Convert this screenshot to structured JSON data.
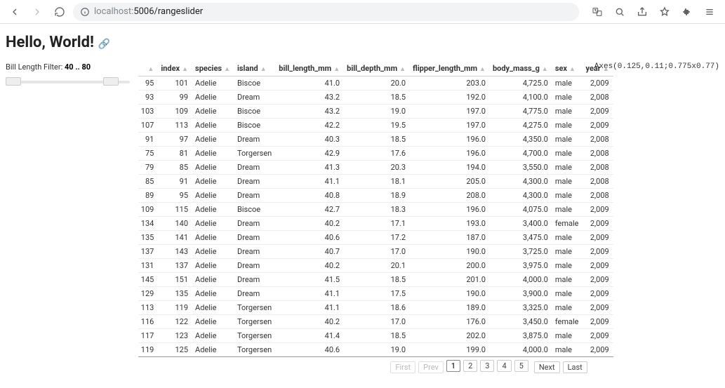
{
  "browser": {
    "url_host": "localhost:",
    "url_path": "5006/rangeslider"
  },
  "page": {
    "title": "Hello, World!",
    "slider_label_prefix": "Bill Length Filter: ",
    "slider_values": "40 .. 80",
    "slider_min_pct": 0,
    "slider_max_pct": 78,
    "axes_text": "Axes(0.125,0.11;0.775x0.77)"
  },
  "columns": [
    {
      "key": "rownum",
      "label": "",
      "num": true
    },
    {
      "key": "index",
      "label": "index",
      "num": true
    },
    {
      "key": "species",
      "label": "species",
      "num": false
    },
    {
      "key": "island",
      "label": "island",
      "num": false
    },
    {
      "key": "bill_length_mm",
      "label": "bill_length_mm",
      "num": true
    },
    {
      "key": "bill_depth_mm",
      "label": "bill_depth_mm",
      "num": true
    },
    {
      "key": "flipper_length_mm",
      "label": "flipper_length_mm",
      "num": true
    },
    {
      "key": "body_mass_g",
      "label": "body_mass_g",
      "num": true
    },
    {
      "key": "sex",
      "label": "sex",
      "num": false
    },
    {
      "key": "year",
      "label": "year",
      "num": true
    }
  ],
  "rows": [
    {
      "rownum": "95",
      "index": "101",
      "species": "Adelie",
      "island": "Biscoe",
      "bill_length_mm": "41.0",
      "bill_depth_mm": "20.0",
      "flipper_length_mm": "203.0",
      "body_mass_g": "4,725.0",
      "sex": "male",
      "year": "2,009"
    },
    {
      "rownum": "93",
      "index": "99",
      "species": "Adelie",
      "island": "Dream",
      "bill_length_mm": "43.2",
      "bill_depth_mm": "18.5",
      "flipper_length_mm": "192.0",
      "body_mass_g": "4,100.0",
      "sex": "male",
      "year": "2,008"
    },
    {
      "rownum": "103",
      "index": "109",
      "species": "Adelie",
      "island": "Biscoe",
      "bill_length_mm": "43.2",
      "bill_depth_mm": "19.0",
      "flipper_length_mm": "197.0",
      "body_mass_g": "4,775.0",
      "sex": "male",
      "year": "2,009"
    },
    {
      "rownum": "107",
      "index": "113",
      "species": "Adelie",
      "island": "Biscoe",
      "bill_length_mm": "42.2",
      "bill_depth_mm": "19.5",
      "flipper_length_mm": "197.0",
      "body_mass_g": "4,275.0",
      "sex": "male",
      "year": "2,009"
    },
    {
      "rownum": "91",
      "index": "97",
      "species": "Adelie",
      "island": "Dream",
      "bill_length_mm": "40.3",
      "bill_depth_mm": "18.5",
      "flipper_length_mm": "196.0",
      "body_mass_g": "4,350.0",
      "sex": "male",
      "year": "2,008"
    },
    {
      "rownum": "75",
      "index": "81",
      "species": "Adelie",
      "island": "Torgersen",
      "bill_length_mm": "42.9",
      "bill_depth_mm": "17.6",
      "flipper_length_mm": "196.0",
      "body_mass_g": "4,700.0",
      "sex": "male",
      "year": "2,008"
    },
    {
      "rownum": "79",
      "index": "85",
      "species": "Adelie",
      "island": "Dream",
      "bill_length_mm": "41.3",
      "bill_depth_mm": "20.3",
      "flipper_length_mm": "194.0",
      "body_mass_g": "3,550.0",
      "sex": "male",
      "year": "2,008"
    },
    {
      "rownum": "85",
      "index": "91",
      "species": "Adelie",
      "island": "Dream",
      "bill_length_mm": "41.1",
      "bill_depth_mm": "18.1",
      "flipper_length_mm": "205.0",
      "body_mass_g": "4,300.0",
      "sex": "male",
      "year": "2,008"
    },
    {
      "rownum": "89",
      "index": "95",
      "species": "Adelie",
      "island": "Dream",
      "bill_length_mm": "40.8",
      "bill_depth_mm": "18.9",
      "flipper_length_mm": "208.0",
      "body_mass_g": "4,300.0",
      "sex": "male",
      "year": "2,008"
    },
    {
      "rownum": "109",
      "index": "115",
      "species": "Adelie",
      "island": "Biscoe",
      "bill_length_mm": "42.7",
      "bill_depth_mm": "18.3",
      "flipper_length_mm": "196.0",
      "body_mass_g": "4,075.0",
      "sex": "male",
      "year": "2,009"
    },
    {
      "rownum": "134",
      "index": "140",
      "species": "Adelie",
      "island": "Dream",
      "bill_length_mm": "40.2",
      "bill_depth_mm": "17.1",
      "flipper_length_mm": "193.0",
      "body_mass_g": "3,400.0",
      "sex": "female",
      "year": "2,009"
    },
    {
      "rownum": "135",
      "index": "141",
      "species": "Adelie",
      "island": "Dream",
      "bill_length_mm": "40.6",
      "bill_depth_mm": "17.2",
      "flipper_length_mm": "187.0",
      "body_mass_g": "3,475.0",
      "sex": "male",
      "year": "2,009"
    },
    {
      "rownum": "137",
      "index": "143",
      "species": "Adelie",
      "island": "Dream",
      "bill_length_mm": "40.7",
      "bill_depth_mm": "17.0",
      "flipper_length_mm": "190.0",
      "body_mass_g": "3,725.0",
      "sex": "male",
      "year": "2,009"
    },
    {
      "rownum": "131",
      "index": "137",
      "species": "Adelie",
      "island": "Dream",
      "bill_length_mm": "40.2",
      "bill_depth_mm": "20.1",
      "flipper_length_mm": "200.0",
      "body_mass_g": "3,975.0",
      "sex": "male",
      "year": "2,009"
    },
    {
      "rownum": "145",
      "index": "151",
      "species": "Adelie",
      "island": "Dream",
      "bill_length_mm": "41.5",
      "bill_depth_mm": "18.5",
      "flipper_length_mm": "201.0",
      "body_mass_g": "4,000.0",
      "sex": "male",
      "year": "2,009"
    },
    {
      "rownum": "129",
      "index": "135",
      "species": "Adelie",
      "island": "Dream",
      "bill_length_mm": "41.1",
      "bill_depth_mm": "17.5",
      "flipper_length_mm": "190.0",
      "body_mass_g": "3,900.0",
      "sex": "male",
      "year": "2,009"
    },
    {
      "rownum": "113",
      "index": "119",
      "species": "Adelie",
      "island": "Torgersen",
      "bill_length_mm": "41.1",
      "bill_depth_mm": "18.6",
      "flipper_length_mm": "189.0",
      "body_mass_g": "3,325.0",
      "sex": "male",
      "year": "2,009"
    },
    {
      "rownum": "116",
      "index": "122",
      "species": "Adelie",
      "island": "Torgersen",
      "bill_length_mm": "40.2",
      "bill_depth_mm": "17.0",
      "flipper_length_mm": "176.0",
      "body_mass_g": "3,450.0",
      "sex": "female",
      "year": "2,009"
    },
    {
      "rownum": "117",
      "index": "123",
      "species": "Adelie",
      "island": "Torgersen",
      "bill_length_mm": "41.4",
      "bill_depth_mm": "18.5",
      "flipper_length_mm": "202.0",
      "body_mass_g": "3,875.0",
      "sex": "male",
      "year": "2,009"
    },
    {
      "rownum": "119",
      "index": "125",
      "species": "Adelie",
      "island": "Torgersen",
      "bill_length_mm": "40.6",
      "bill_depth_mm": "19.0",
      "flipper_length_mm": "199.0",
      "body_mass_g": "4,000.0",
      "sex": "male",
      "year": "2,009"
    }
  ],
  "pager": {
    "first": "First",
    "prev": "Prev",
    "pages": [
      "1",
      "2",
      "3",
      "4",
      "5"
    ],
    "next": "Next",
    "last": "Last",
    "active": "1"
  }
}
